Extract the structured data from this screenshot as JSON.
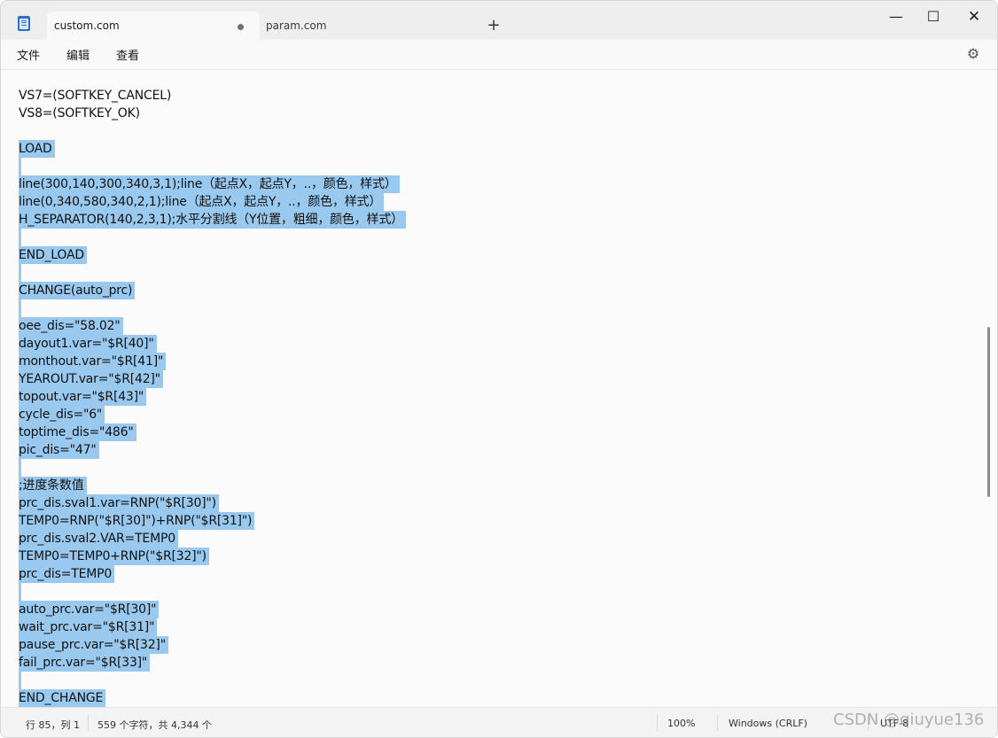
{
  "tabs": [
    {
      "label": "custom.com",
      "active": true,
      "unsaved_dot": true
    },
    {
      "label": "param.com",
      "active": false
    }
  ],
  "new_tab": "+",
  "window_controls": {
    "minimize": "—",
    "maximize": "☐",
    "close": "✕"
  },
  "menu": {
    "file": "文件",
    "edit": "编辑",
    "view": "查看"
  },
  "icons": {
    "app": "notepad-icon",
    "settings": "gear-icon"
  },
  "selection_color": "#99c9ef",
  "editor": {
    "lines": [
      {
        "text": "VS7=(SOFTKEY_CANCEL)",
        "selected": false
      },
      {
        "text": "VS8=(SOFTKEY_OK)",
        "selected": false
      },
      {
        "text": "",
        "selected": false
      },
      {
        "text": "LOAD",
        "selected": true
      },
      {
        "text": "",
        "selected": true
      },
      {
        "text": "line(300,140,300,340,3,1);line（起点X，起点Y，..，颜色，样式）",
        "selected": true
      },
      {
        "text": "line(0,340,580,340,2,1);line（起点X，起点Y，..，颜色，样式）",
        "selected": true
      },
      {
        "text": "H_SEPARATOR(140,2,3,1);水平分割线（Y位置，粗细，颜色，样式）",
        "selected": true
      },
      {
        "text": "",
        "selected": true
      },
      {
        "text": "END_LOAD",
        "selected": true
      },
      {
        "text": "",
        "selected": true
      },
      {
        "text": "CHANGE(auto_prc)",
        "selected": true
      },
      {
        "text": "",
        "selected": true
      },
      {
        "text": "oee_dis=\"58.02\"",
        "selected": true
      },
      {
        "text": "dayout1.var=\"$R[40]\"",
        "selected": true
      },
      {
        "text": "monthout.var=\"$R[41]\"",
        "selected": true
      },
      {
        "text": "YEAROUT.var=\"$R[42]\"",
        "selected": true
      },
      {
        "text": "topout.var=\"$R[43]\"",
        "selected": true
      },
      {
        "text": "cycle_dis=\"6\"",
        "selected": true
      },
      {
        "text": "toptime_dis=\"486\"",
        "selected": true
      },
      {
        "text": "pic_dis=\"47\"",
        "selected": true
      },
      {
        "text": "",
        "selected": true
      },
      {
        "text": ";进度条数值",
        "selected": true
      },
      {
        "text": "prc_dis.sval1.var=RNP(\"$R[30]\")",
        "selected": true
      },
      {
        "text": "TEMP0=RNP(\"$R[30]\")+RNP(\"$R[31]\")",
        "selected": true
      },
      {
        "text": "prc_dis.sval2.VAR=TEMP0",
        "selected": true
      },
      {
        "text": "TEMP0=TEMP0+RNP(\"$R[32]\")",
        "selected": true
      },
      {
        "text": "prc_dis=TEMP0",
        "selected": true
      },
      {
        "text": "",
        "selected": true
      },
      {
        "text": "auto_prc.var=\"$R[30]\"",
        "selected": true
      },
      {
        "text": "wait_prc.var=\"$R[31]\"",
        "selected": true
      },
      {
        "text": "pause_prc.var=\"$R[32]\"",
        "selected": true
      },
      {
        "text": "fail_prc.var=\"$R[33]\"",
        "selected": true
      },
      {
        "text": "",
        "selected": true
      },
      {
        "text": "END_CHANGE",
        "selected": true
      }
    ]
  },
  "status": {
    "position": "行 85，列 1",
    "selection": "559 个字符，共 4,344 个",
    "zoom": "100%",
    "line_ending": "Windows (CRLF)",
    "encoding": "UTF-8"
  },
  "watermark": "CSDN @qiuyue136"
}
